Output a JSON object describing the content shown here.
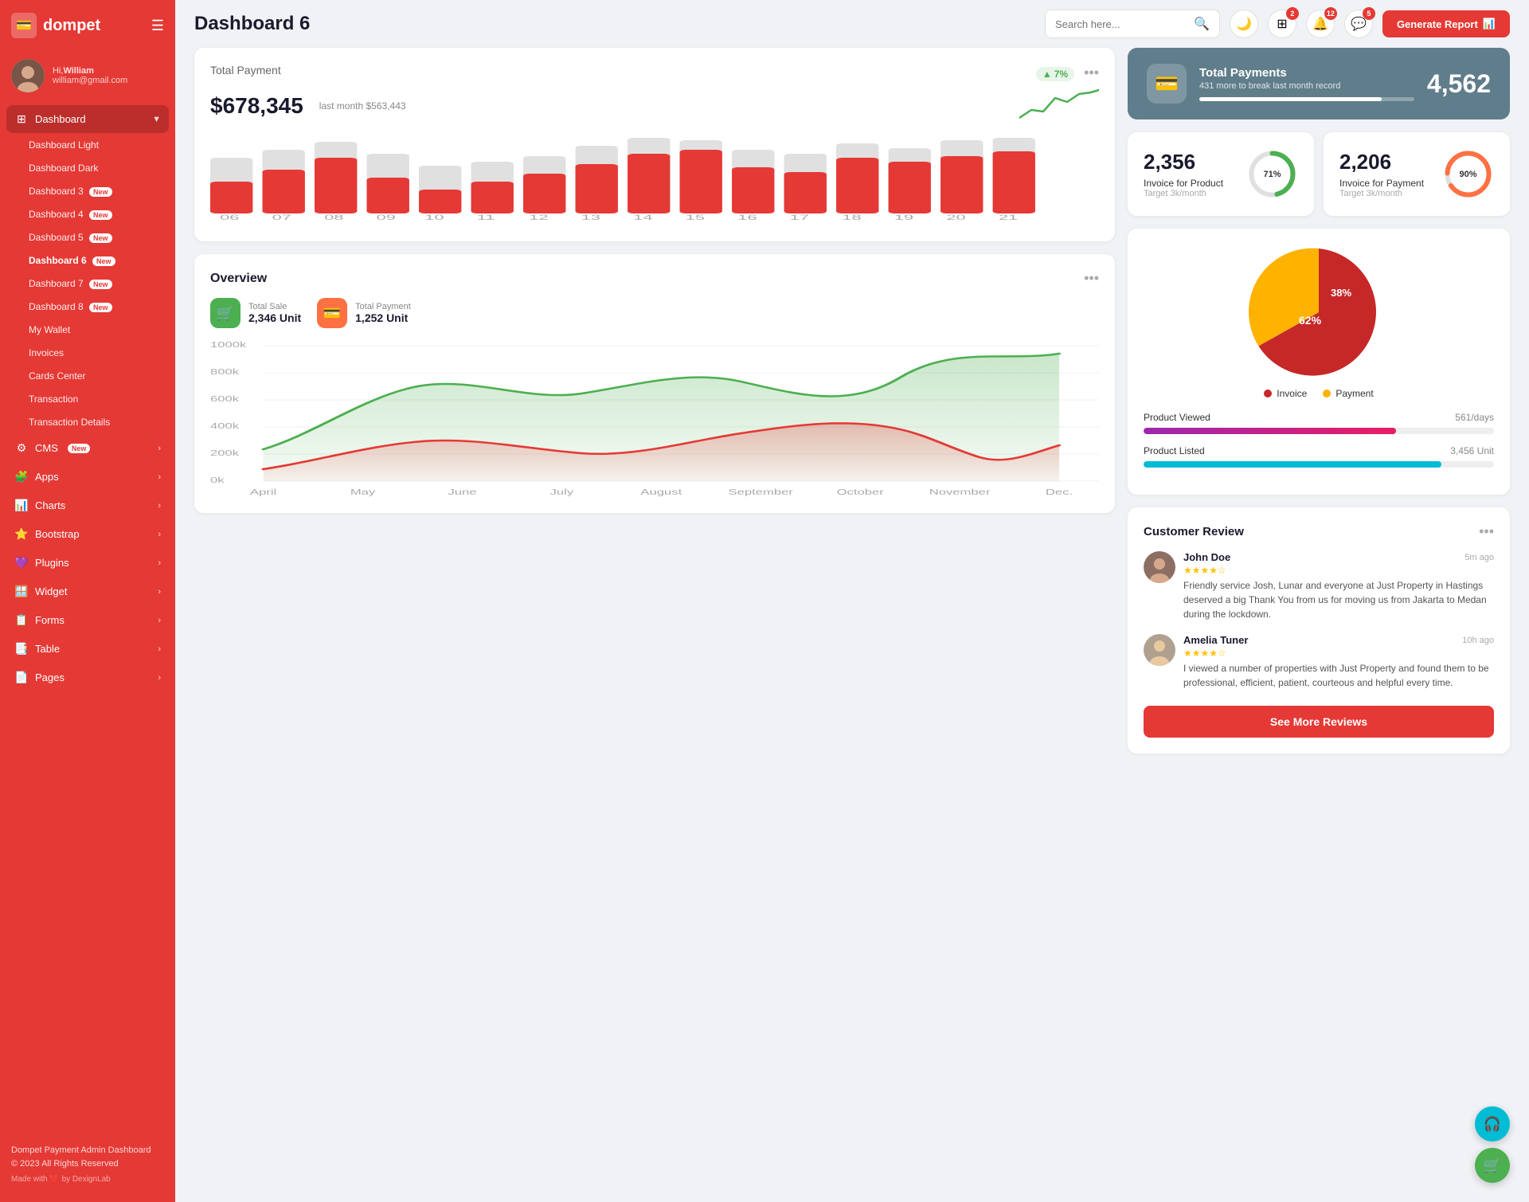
{
  "app": {
    "name": "dompet",
    "logo_icon": "💳"
  },
  "user": {
    "greeting": "Hi,",
    "name": "William",
    "email": "william@gmail.com"
  },
  "topbar": {
    "title": "Dashboard 6",
    "search_placeholder": "Search here...",
    "generate_btn": "Generate Report",
    "icons": {
      "moon": "🌙",
      "apps": "⊞",
      "bell": "🔔",
      "message": "💬"
    },
    "badges": {
      "apps": "2",
      "bell": "12",
      "message": "5"
    }
  },
  "sidebar": {
    "dashboard_label": "Dashboard",
    "sub_items": [
      {
        "label": "Dashboard Light",
        "badge": ""
      },
      {
        "label": "Dashboard Dark",
        "badge": ""
      },
      {
        "label": "Dashboard 3",
        "badge": "New"
      },
      {
        "label": "Dashboard 4",
        "badge": "New"
      },
      {
        "label": "Dashboard 5",
        "badge": "New"
      },
      {
        "label": "Dashboard 6",
        "badge": "New",
        "active": true
      },
      {
        "label": "Dashboard 7",
        "badge": "New"
      },
      {
        "label": "Dashboard 8",
        "badge": "New"
      },
      {
        "label": "My Wallet",
        "badge": ""
      },
      {
        "label": "Invoices",
        "badge": ""
      },
      {
        "label": "Cards Center",
        "badge": ""
      },
      {
        "label": "Transaction",
        "badge": ""
      },
      {
        "label": "Transaction Details",
        "badge": ""
      }
    ],
    "nav_items": [
      {
        "icon": "⚙️",
        "label": "CMS",
        "badge": "New",
        "has_arrow": true
      },
      {
        "icon": "🧩",
        "label": "Apps",
        "badge": "",
        "has_arrow": true
      },
      {
        "icon": "📊",
        "label": "Charts",
        "badge": "",
        "has_arrow": true
      },
      {
        "icon": "⭐",
        "label": "Bootstrap",
        "badge": "",
        "has_arrow": true
      },
      {
        "icon": "💜",
        "label": "Plugins",
        "badge": "",
        "has_arrow": true
      },
      {
        "icon": "🪟",
        "label": "Widget",
        "badge": "",
        "has_arrow": true
      },
      {
        "icon": "📋",
        "label": "Forms",
        "badge": "",
        "has_arrow": true
      },
      {
        "icon": "📑",
        "label": "Table",
        "badge": "",
        "has_arrow": true
      },
      {
        "icon": "📄",
        "label": "Pages",
        "badge": "",
        "has_arrow": true
      }
    ],
    "footer": {
      "title": "Dompet Payment Admin Dashboard",
      "copy": "© 2023 All Rights Reserved",
      "made": "Made with ❤️ by DexignLab"
    }
  },
  "total_payment": {
    "title": "Total Payment",
    "amount": "$678,345",
    "last_month_label": "last month $563,443",
    "trend_pct": "7%",
    "bars": [
      {
        "label": "06",
        "h1": 60,
        "h2": 30
      },
      {
        "label": "07",
        "h1": 70,
        "h2": 55
      },
      {
        "label": "08",
        "h1": 80,
        "h2": 70
      },
      {
        "label": "09",
        "h1": 65,
        "h2": 40
      },
      {
        "label": "10",
        "h1": 50,
        "h2": 25
      },
      {
        "label": "11",
        "h1": 55,
        "h2": 35
      },
      {
        "label": "12",
        "h1": 60,
        "h2": 45
      },
      {
        "label": "13",
        "h1": 75,
        "h2": 60
      },
      {
        "label": "14",
        "h1": 85,
        "h2": 70
      },
      {
        "label": "15",
        "h1": 90,
        "h2": 80
      },
      {
        "label": "16",
        "h1": 70,
        "h2": 55
      },
      {
        "label": "17",
        "h1": 65,
        "h2": 50
      },
      {
        "label": "18",
        "h1": 80,
        "h2": 65
      },
      {
        "label": "19",
        "h1": 75,
        "h2": 60
      },
      {
        "label": "20",
        "h1": 85,
        "h2": 70
      },
      {
        "label": "21",
        "h1": 90,
        "h2": 75
      }
    ]
  },
  "total_payments_banner": {
    "title": "Total Payments",
    "sub": "431 more to break last month record",
    "count": "4,562",
    "progress_pct": 85
  },
  "invoice_product": {
    "number": "2,356",
    "label": "Invoice for Product",
    "target": "Target 3k/month",
    "pct": 71,
    "color": "#4caf50"
  },
  "invoice_payment": {
    "number": "2,206",
    "label": "Invoice for Payment",
    "target": "Target 3k/month",
    "pct": 90,
    "color": "#ff7043"
  },
  "overview": {
    "title": "Overview",
    "total_sale_label": "Total Sale",
    "total_sale_value": "2,346 Unit",
    "total_payment_label": "Total Payment",
    "total_payment_value": "1,252 Unit",
    "months": [
      "April",
      "May",
      "June",
      "July",
      "August",
      "September",
      "October",
      "November",
      "Dec."
    ],
    "y_labels": [
      "1000k",
      "800k",
      "600k",
      "400k",
      "200k",
      "0k"
    ]
  },
  "pie_chart": {
    "invoice_pct": 62,
    "payment_pct": 38,
    "invoice_label": "Invoice",
    "payment_label": "Payment",
    "invoice_color": "#c62828",
    "payment_color": "#ffb300"
  },
  "product_viewed": {
    "label": "Product Viewed",
    "value": "561/days",
    "pct": 72
  },
  "product_listed": {
    "label": "Product Listed",
    "value": "3,456 Unit",
    "pct": 85
  },
  "customer_review": {
    "title": "Customer Review",
    "reviews": [
      {
        "name": "John Doe",
        "time": "5m ago",
        "stars": 4,
        "text": "Friendly service Josh, Lunar and everyone at Just Property in Hastings deserved a big Thank You from us for moving us from Jakarta to Medan during the lockdown."
      },
      {
        "name": "Amelia Tuner",
        "time": "10h ago",
        "stars": 4,
        "text": "I viewed a number of properties with Just Property and found them to be professional, efficient, patient, courteous and helpful every time."
      }
    ],
    "see_more_btn": "See More Reviews"
  }
}
